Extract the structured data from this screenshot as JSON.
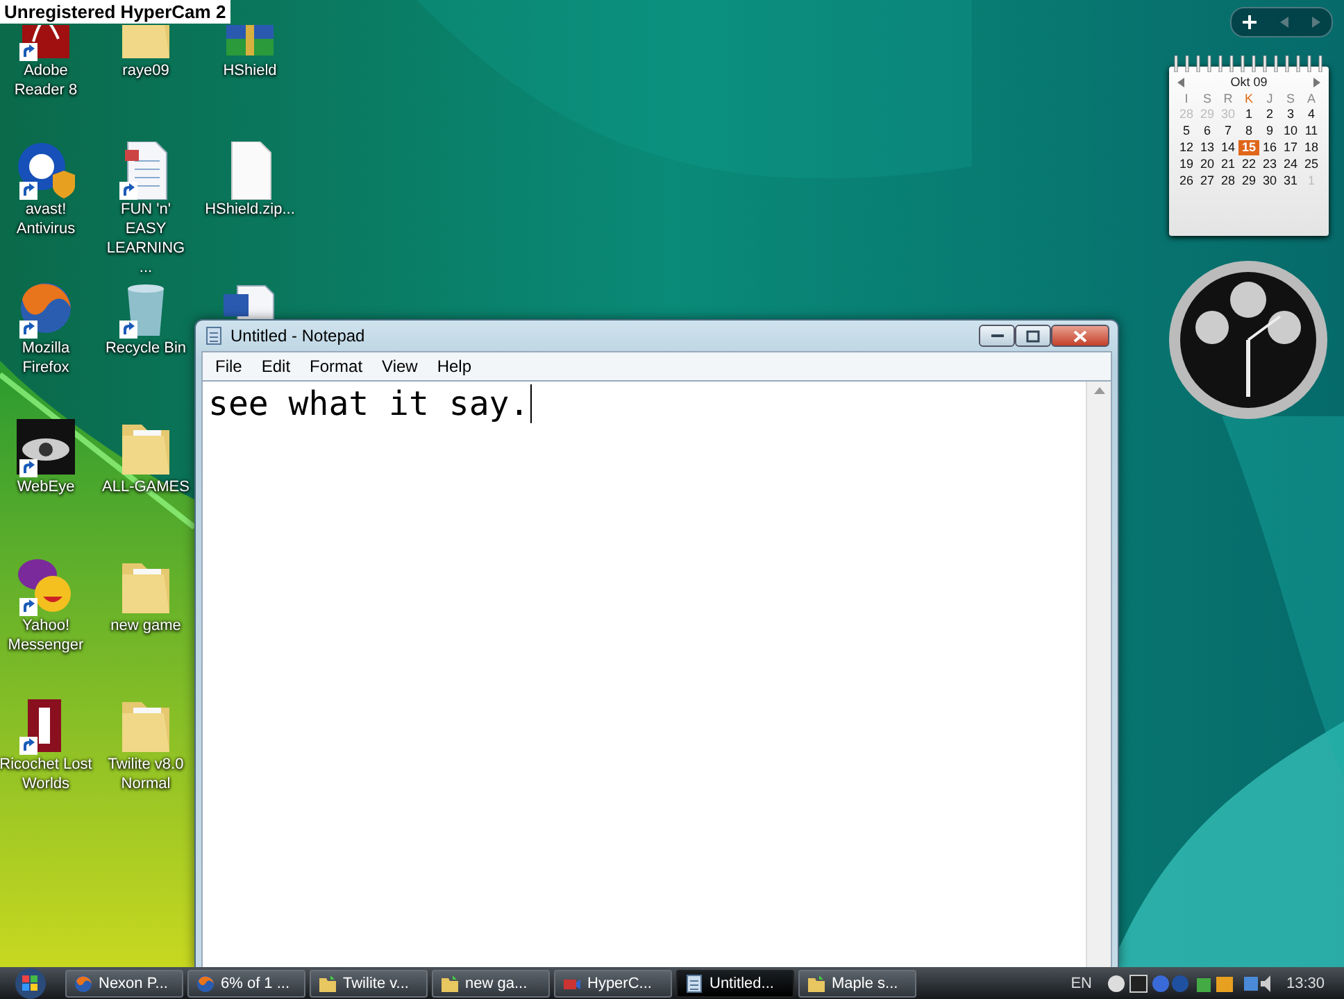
{
  "recorder_watermark": "Unregistered HyperCam 2",
  "desktop_icon_rows": [
    [
      {
        "label": "Adobe Reader 8",
        "kind": "pdf",
        "shortcut": true
      },
      {
        "label": "raye09",
        "kind": "folder",
        "shortcut": false
      },
      {
        "label": "HShield",
        "kind": "archive",
        "shortcut": false
      }
    ],
    [
      {
        "label": "avast! Antivirus",
        "kind": "antivirus",
        "shortcut": true
      },
      {
        "label": "FUN 'n' EASY LEARNING ...",
        "kind": "document",
        "shortcut": true
      },
      {
        "label": "HShield.zip...",
        "kind": "blank",
        "shortcut": false
      }
    ],
    [
      {
        "label": "Mozilla Firefox",
        "kind": "browser",
        "shortcut": true
      },
      {
        "label": "Recycle Bin",
        "kind": "bin",
        "shortcut": true
      },
      {
        "kind": "word",
        "shortcut": false
      }
    ],
    [
      {
        "label": "WebEye",
        "kind": "eye",
        "shortcut": true
      },
      {
        "label": "ALL-GAMES",
        "kind": "folder",
        "shortcut": false
      }
    ],
    [
      {
        "label": "Yahoo! Messenger",
        "kind": "messenger",
        "shortcut": true
      },
      {
        "label": "new game",
        "kind": "folder",
        "shortcut": false
      }
    ],
    [
      {
        "label": "Ricochet Lost Worlds",
        "kind": "game",
        "shortcut": true
      },
      {
        "label": "Twilite v8.0 Normal",
        "kind": "folder",
        "shortcut": false
      }
    ]
  ],
  "notepad": {
    "title": "Untitled - Notepad",
    "menu": [
      "File",
      "Edit",
      "Format",
      "View",
      "Help"
    ],
    "text": "see what it say."
  },
  "calendar": {
    "month": "Okt 09",
    "weekdays": [
      {
        "label": "I",
        "today": false
      },
      {
        "label": "S",
        "today": false
      },
      {
        "label": "R",
        "today": false
      },
      {
        "label": "K",
        "today": true
      },
      {
        "label": "J",
        "today": false
      },
      {
        "label": "S",
        "today": false
      },
      {
        "label": "A",
        "today": false
      }
    ],
    "weeks": [
      [
        {
          "label": "28",
          "other_month": true,
          "selected": false
        },
        {
          "label": "29",
          "other_month": true,
          "selected": false
        },
        {
          "label": "30",
          "other_month": true,
          "selected": false
        },
        {
          "label": "1",
          "other_month": false,
          "selected": false
        },
        {
          "label": "2",
          "other_month": false,
          "selected": false
        },
        {
          "label": "3",
          "other_month": false,
          "selected": false
        },
        {
          "label": "4",
          "other_month": false,
          "selected": false
        }
      ],
      [
        {
          "label": "5",
          "other_month": false,
          "selected": false
        },
        {
          "label": "6",
          "other_month": false,
          "selected": false
        },
        {
          "label": "7",
          "other_month": false,
          "selected": false
        },
        {
          "label": "8",
          "other_month": false,
          "selected": false
        },
        {
          "label": "9",
          "other_month": false,
          "selected": false
        },
        {
          "label": "10",
          "other_month": false,
          "selected": false
        },
        {
          "label": "11",
          "other_month": false,
          "selected": false
        }
      ],
      [
        {
          "label": "12",
          "other_month": false,
          "selected": false
        },
        {
          "label": "13",
          "other_month": false,
          "selected": false
        },
        {
          "label": "14",
          "other_month": false,
          "selected": false
        },
        {
          "label": "15",
          "other_month": false,
          "selected": true
        },
        {
          "label": "16",
          "other_month": false,
          "selected": false
        },
        {
          "label": "17",
          "other_month": false,
          "selected": false
        },
        {
          "label": "18",
          "other_month": false,
          "selected": false
        }
      ],
      [
        {
          "label": "19",
          "other_month": false,
          "selected": false
        },
        {
          "label": "20",
          "other_month": false,
          "selected": false
        },
        {
          "label": "21",
          "other_month": false,
          "selected": false
        },
        {
          "label": "22",
          "other_month": false,
          "selected": false
        },
        {
          "label": "23",
          "other_month": false,
          "selected": false
        },
        {
          "label": "24",
          "other_month": false,
          "selected": false
        },
        {
          "label": "25",
          "other_month": false,
          "selected": false
        }
      ],
      [
        {
          "label": "26",
          "other_month": false,
          "selected": false
        },
        {
          "label": "27",
          "other_month": false,
          "selected": false
        },
        {
          "label": "28",
          "other_month": false,
          "selected": false
        },
        {
          "label": "29",
          "other_month": false,
          "selected": false
        },
        {
          "label": "30",
          "other_month": false,
          "selected": false
        },
        {
          "label": "31",
          "other_month": false,
          "selected": false
        },
        {
          "label": "1",
          "other_month": true,
          "selected": false
        }
      ]
    ]
  },
  "taskbar": {
    "tasks": [
      {
        "label": "Nexon P...",
        "kind": "browser",
        "selected": false
      },
      {
        "label": "6% of 1 ...",
        "kind": "browser",
        "selected": false
      },
      {
        "label": "Twilite v...",
        "kind": "folder",
        "selected": false
      },
      {
        "label": "new ga...",
        "kind": "folder",
        "selected": false
      },
      {
        "label": "HyperC...",
        "kind": "recorder",
        "selected": false
      },
      {
        "label": "Untitled...",
        "kind": "notepad",
        "selected": true
      },
      {
        "label": "Maple s...",
        "kind": "folder",
        "selected": false
      }
    ],
    "language": "EN",
    "time": "13:30"
  }
}
